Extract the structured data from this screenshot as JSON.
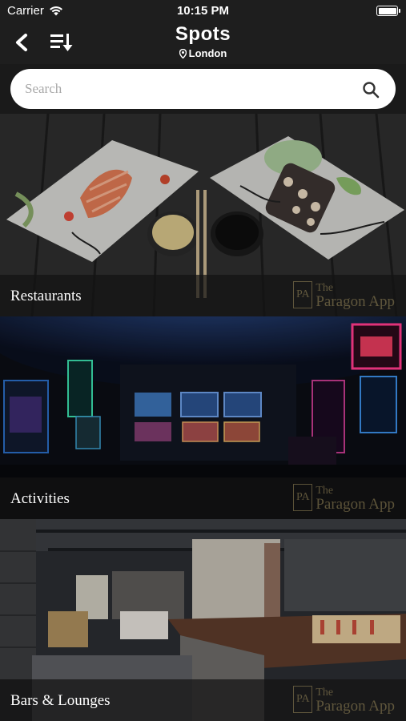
{
  "status_bar": {
    "carrier": "Carrier",
    "time": "10:15 PM"
  },
  "nav": {
    "title": "Spots",
    "location": "London"
  },
  "search": {
    "placeholder": "Search"
  },
  "categories": [
    {
      "label": "Restaurants",
      "watermark_line1": "The",
      "watermark_line2": "Paragon App"
    },
    {
      "label": "Activities",
      "watermark_line1": "The",
      "watermark_line2": "Paragon App"
    },
    {
      "label": "Bars & Lounges",
      "watermark_line1": "The",
      "watermark_line2": "Paragon App"
    }
  ],
  "watermark_logo_text": "PA",
  "colors": {
    "background": "#1c1c1c",
    "search_bg": "#ffffff",
    "watermark": "#9a8a5a"
  }
}
